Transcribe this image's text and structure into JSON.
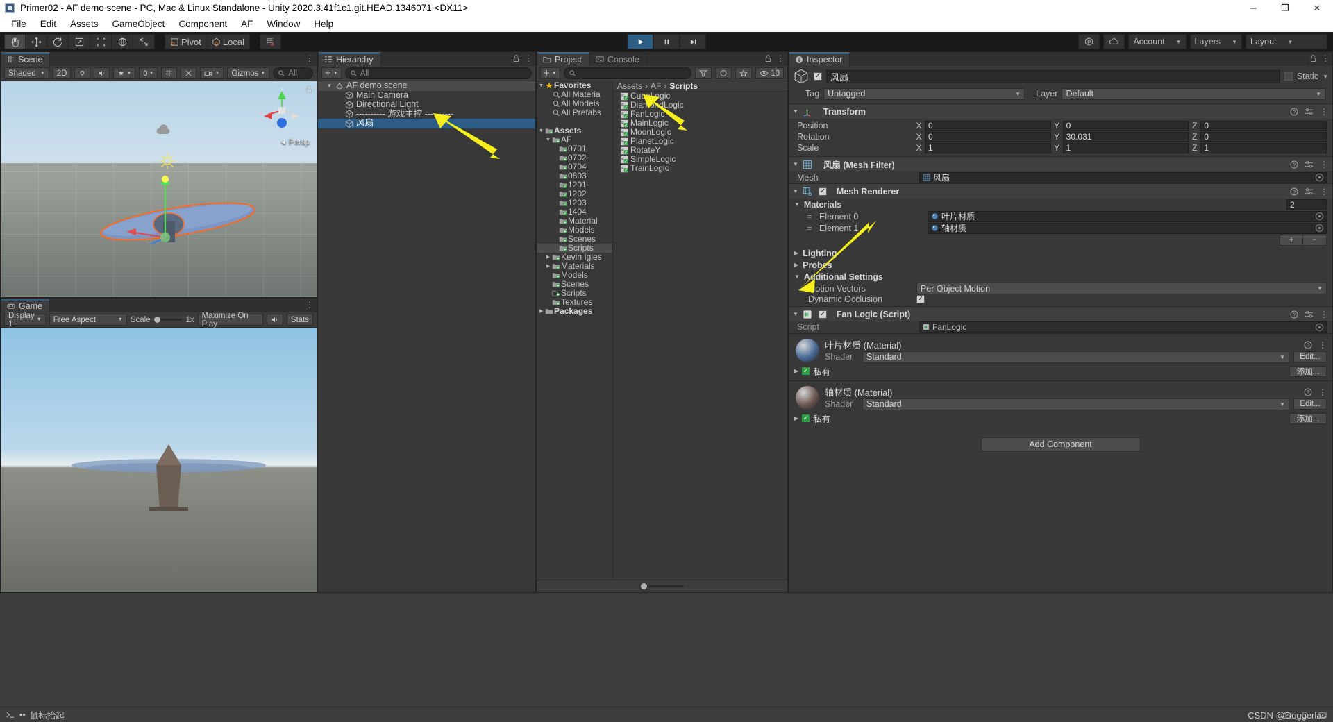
{
  "window": {
    "title": "Primer02 - AF demo scene - PC, Mac & Linux Standalone - Unity 2020.3.41f1c1.git.HEAD.1346071 <DX11>",
    "minimize": "─",
    "maximize": "❐",
    "close": "✕"
  },
  "menubar": {
    "items": [
      "File",
      "Edit",
      "Assets",
      "GameObject",
      "Component",
      "AF",
      "Window",
      "Help"
    ]
  },
  "toolbar": {
    "tools": [
      "hand-tool",
      "move-tool",
      "rotate-tool",
      "scale-tool",
      "rect-tool",
      "transform-tool",
      "custom-tool"
    ],
    "pivot_label": "Pivot",
    "local_label": "Local",
    "snap_label": "grid-snap",
    "play_label": "▶",
    "pause_label": "❙❙",
    "step_label": "▶❙",
    "cloud_label": "cloud-icon",
    "collab_label": "collab-icon",
    "account_label": "Account",
    "layers_label": "Layers",
    "layout_label": "Layout"
  },
  "scene": {
    "tab": "Scene",
    "shading": "Shaded",
    "mode_2d": "2D",
    "gizmos_label": "Gizmos",
    "audio_icon": "audio-icon",
    "light_icon": "light-icon",
    "fx_icon": "fx-icon",
    "camera_icon": "camera-icon",
    "search_placeholder": "All",
    "persp_label": "Persp",
    "axis_x": "x",
    "axis_y": "y",
    "axis_z": "z"
  },
  "game": {
    "tab": "Game",
    "display": "Display 1",
    "aspect": "Free Aspect",
    "scale_label": "Scale",
    "scale_value": "1x",
    "maximize_label": "Maximize On Play",
    "mute_label": "mute-audio-icon",
    "stats_label": "Stats"
  },
  "hierarchy": {
    "tab": "Hierarchy",
    "add_label": "+",
    "search_placeholder": "All",
    "rows": [
      {
        "label": "AF demo scene",
        "depth": 0,
        "icon": "scene-icon",
        "arrow": "▼",
        "selected": false,
        "header": true
      },
      {
        "label": "Main Camera",
        "depth": 1,
        "icon": "gameobject-icon",
        "arrow": "",
        "selected": false,
        "header": false
      },
      {
        "label": "Directional Light",
        "depth": 1,
        "icon": "gameobject-icon",
        "arrow": "",
        "selected": false,
        "header": false
      },
      {
        "label": "---------- 游戏主控 ----------",
        "depth": 1,
        "icon": "gameobject-icon",
        "arrow": "",
        "selected": false,
        "header": false
      },
      {
        "label": "风扇",
        "depth": 1,
        "icon": "gameobject-icon",
        "arrow": "",
        "selected": true,
        "header": false
      }
    ]
  },
  "project": {
    "tab": "Project",
    "console_tab": "Console",
    "add_label": "+",
    "search_placeholder": "",
    "breadcrumb": [
      "Assets",
      "AF",
      "Scripts"
    ],
    "tree": [
      {
        "label": "Favorites",
        "depth": 0,
        "icon": "star-icon",
        "arrow": "▼",
        "bold": true,
        "sel": false
      },
      {
        "label": "All Materia",
        "depth": 1,
        "icon": "search-icon",
        "arrow": "",
        "bold": false,
        "sel": false
      },
      {
        "label": "All Models",
        "depth": 1,
        "icon": "search-icon",
        "arrow": "",
        "bold": false,
        "sel": false
      },
      {
        "label": "All Prefabs",
        "depth": 1,
        "icon": "search-icon",
        "arrow": "",
        "bold": false,
        "sel": false
      },
      {
        "label": "",
        "depth": 0,
        "icon": "",
        "arrow": "",
        "bold": false,
        "sel": false
      },
      {
        "label": "Assets",
        "depth": 0,
        "icon": "folder-icon",
        "arrow": "▼",
        "bold": true,
        "sel": false
      },
      {
        "label": "AF",
        "depth": 1,
        "icon": "folder-icon",
        "arrow": "▼",
        "bold": false,
        "sel": false
      },
      {
        "label": "0701",
        "depth": 2,
        "icon": "folder-icon",
        "arrow": "",
        "bold": false,
        "sel": false
      },
      {
        "label": "0702",
        "depth": 2,
        "icon": "folder-icon",
        "arrow": "",
        "bold": false,
        "sel": false
      },
      {
        "label": "0704",
        "depth": 2,
        "icon": "folder-icon",
        "arrow": "",
        "bold": false,
        "sel": false
      },
      {
        "label": "0803",
        "depth": 2,
        "icon": "folder-icon",
        "arrow": "",
        "bold": false,
        "sel": false
      },
      {
        "label": "1201",
        "depth": 2,
        "icon": "folder-script-icon",
        "arrow": "",
        "bold": false,
        "sel": false
      },
      {
        "label": "1202",
        "depth": 2,
        "icon": "folder-script-icon",
        "arrow": "",
        "bold": false,
        "sel": false
      },
      {
        "label": "1203",
        "depth": 2,
        "icon": "folder-script-icon",
        "arrow": "",
        "bold": false,
        "sel": false
      },
      {
        "label": "1404",
        "depth": 2,
        "icon": "folder-script-icon",
        "arrow": "",
        "bold": false,
        "sel": false
      },
      {
        "label": "Material",
        "depth": 2,
        "icon": "folder-icon",
        "arrow": "",
        "bold": false,
        "sel": false
      },
      {
        "label": "Models",
        "depth": 2,
        "icon": "folder-icon",
        "arrow": "",
        "bold": false,
        "sel": false
      },
      {
        "label": "Scenes",
        "depth": 2,
        "icon": "folder-icon",
        "arrow": "",
        "bold": false,
        "sel": false
      },
      {
        "label": "Scripts",
        "depth": 2,
        "icon": "folder-icon",
        "arrow": "",
        "bold": false,
        "sel": true
      },
      {
        "label": "Kevin Igles",
        "depth": 1,
        "icon": "folder-icon",
        "arrow": "▶",
        "bold": false,
        "sel": false
      },
      {
        "label": "Materials",
        "depth": 1,
        "icon": "folder-icon",
        "arrow": "▶",
        "bold": false,
        "sel": false
      },
      {
        "label": "Models",
        "depth": 1,
        "icon": "folder-icon",
        "arrow": "",
        "bold": false,
        "sel": false
      },
      {
        "label": "Scenes",
        "depth": 1,
        "icon": "folder-icon",
        "arrow": "",
        "bold": false,
        "sel": false
      },
      {
        "label": "Scripts",
        "depth": 1,
        "icon": "folder-open-icon",
        "arrow": "",
        "bold": false,
        "sel": false
      },
      {
        "label": "Textures",
        "depth": 1,
        "icon": "folder-icon",
        "arrow": "",
        "bold": false,
        "sel": false
      },
      {
        "label": "Packages",
        "depth": 0,
        "icon": "package-icon",
        "arrow": "▶",
        "bold": true,
        "sel": false
      }
    ],
    "files": [
      {
        "label": "CubeLogic",
        "icon": "cs-script-icon"
      },
      {
        "label": "DiamondLogic",
        "icon": "cs-script-icon"
      },
      {
        "label": "FanLogic",
        "icon": "cs-script-icon"
      },
      {
        "label": "MainLogic",
        "icon": "cs-script-icon"
      },
      {
        "label": "MoonLogic",
        "icon": "cs-script-icon"
      },
      {
        "label": "PlanetLogic",
        "icon": "cs-script-icon"
      },
      {
        "label": "RotateY",
        "icon": "cs-script-icon"
      },
      {
        "label": "SimpleLogic",
        "icon": "cs-script-icon"
      },
      {
        "label": "TrainLogic",
        "icon": "cs-script-icon"
      }
    ]
  },
  "inspector": {
    "tab": "Inspector",
    "object_name": "风扇",
    "enabled": true,
    "static_label": "Static",
    "tag_label": "Tag",
    "tag_value": "Untagged",
    "layer_label": "Layer",
    "layer_value": "Default",
    "transform": {
      "title": "Transform",
      "rows": [
        {
          "label": "Position",
          "x": "0",
          "y": "0",
          "z": "0"
        },
        {
          "label": "Rotation",
          "x": "0",
          "y": "30.031",
          "z": "0"
        },
        {
          "label": "Scale",
          "x": "1",
          "y": "1",
          "z": "1"
        }
      ]
    },
    "mesh_filter": {
      "title": "风扇 (Mesh Filter)",
      "mesh_label": "Mesh",
      "mesh_value": "风扇"
    },
    "mesh_renderer": {
      "title": "Mesh Renderer",
      "materials_label": "Materials",
      "materials_count": "2",
      "elements": [
        {
          "label": "Element 0",
          "value": "叶片材质"
        },
        {
          "label": "Element 1",
          "value": "轴材质"
        }
      ],
      "add_label": "+",
      "remove_label": "−",
      "lighting_label": "Lighting",
      "probes_label": "Probes",
      "additional_label": "Additional Settings",
      "motion_vectors_label": "Motion Vectors",
      "motion_vectors_value": "Per Object Motion",
      "dynamic_occlusion_label": "Dynamic Occlusion",
      "dynamic_occlusion_checked": true
    },
    "fan_logic": {
      "title": "Fan Logic (Script)",
      "script_label": "Script",
      "script_value": "FanLogic"
    },
    "materials": [
      {
        "name": "叶片材质 (Material)",
        "shader_label": "Shader",
        "shader_value": "Standard",
        "edit_label": "Edit...",
        "private_label": "私有",
        "add_label": "添加...",
        "color": "#4a6d99"
      },
      {
        "name": "轴材质 (Material)",
        "shader_label": "Shader",
        "shader_value": "Standard",
        "edit_label": "Edit...",
        "private_label": "私有",
        "add_label": "添加...",
        "color": "#6d5a55"
      }
    ],
    "add_component_label": "Add Component"
  },
  "statusbar": {
    "message": "鼠标抬起",
    "prefix": "••"
  },
  "watermark": "CSDN @Doggerlas",
  "colors": {
    "accent_blue": "#2c5d87",
    "panel_bg": "#383838",
    "toolbar_bg": "#191919",
    "annotation_yellow": "#f7ef1c"
  }
}
